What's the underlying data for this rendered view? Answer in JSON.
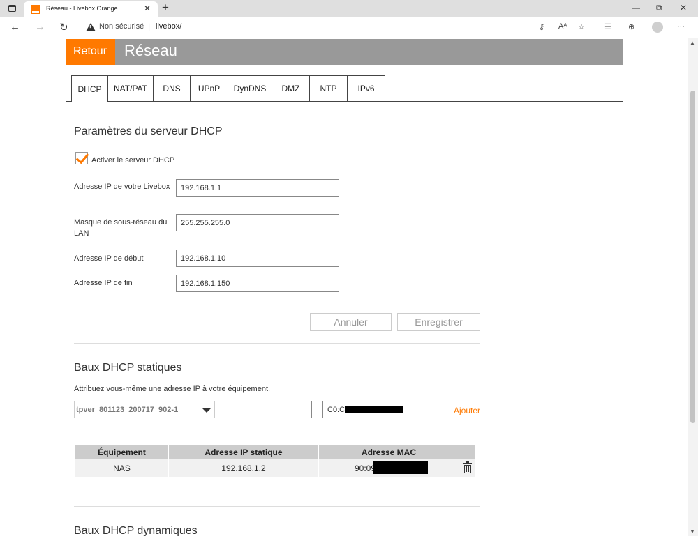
{
  "browser": {
    "tab_title": "Réseau - Livebox Orange",
    "tab_close": "✕",
    "new_tab": "+",
    "insecure_label": "Non sécurisé",
    "separator": "|",
    "url": "livebox/",
    "more": "···"
  },
  "header": {
    "back_label": "Retour",
    "title": "Réseau"
  },
  "tabs": [
    "DHCP",
    "NAT/PAT",
    "DNS",
    "UPnP",
    "DynDNS",
    "DMZ",
    "NTP",
    "IPv6"
  ],
  "dhcp_server": {
    "heading": "Paramètres du serveur DHCP",
    "enable_label": "Activer le serveur DHCP",
    "enabled": true,
    "fields": [
      {
        "label": "Adresse IP de votre Livebox",
        "value": "192.168.1.1"
      },
      {
        "label": "Masque de sous-réseau du LAN",
        "value": "255.255.255.0"
      },
      {
        "label": "Adresse IP de début",
        "value": "192.168.1.10"
      },
      {
        "label": "Adresse IP de fin",
        "value": "192.168.1.150"
      }
    ],
    "cancel_label": "Annuler",
    "save_label": "Enregistrer"
  },
  "static_leases": {
    "heading": "Baux DHCP statiques",
    "hint": "Attribuez vous-même une adresse IP à votre équipement.",
    "device_select": "tpver_801123_200717_902-1",
    "ip_value": "",
    "mac_value": "C0:C",
    "add_label": "Ajouter",
    "columns": [
      "Équipement",
      "Adresse IP statique",
      "Adresse MAC"
    ],
    "rows": [
      {
        "device": "NAS",
        "ip": "192.168.1.2",
        "mac": "90:09"
      }
    ]
  },
  "dynamic_leases": {
    "heading": "Baux DHCP dynamiques"
  },
  "colors": {
    "accent": "#ff7900",
    "header_gray": "#999999",
    "table_header": "#cccccc"
  }
}
